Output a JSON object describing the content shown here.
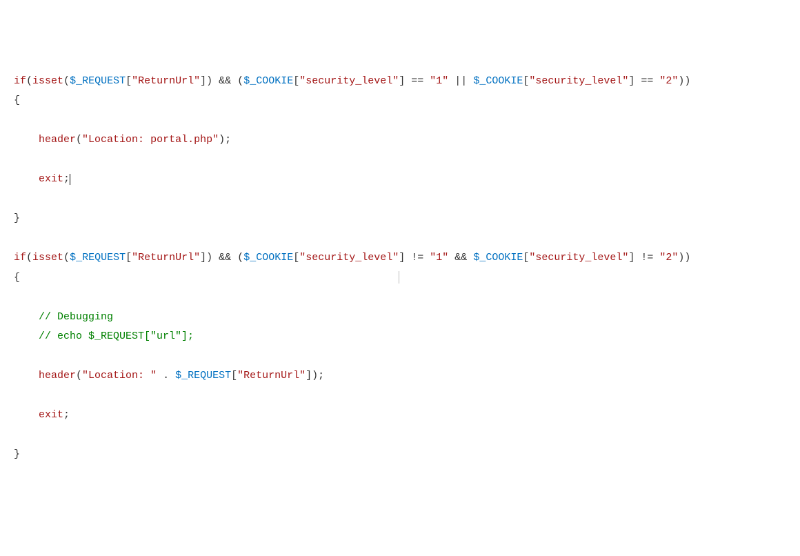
{
  "code": {
    "line1": {
      "kw_if": "if",
      "p_open": "(",
      "kw_isset": "isset",
      "p1": "(",
      "var_req1": "$_REQUEST",
      "br1": "[",
      "str_return": "\"ReturnUrl\"",
      "br1c": "]",
      "p1c": ")",
      "sp_amp": " && ",
      "p2": "(",
      "var_cook1": "$_COOKIE",
      "br2": "[",
      "str_sec1": "\"security_level\"",
      "br2c": "]",
      "eq": " == ",
      "str_1": "\"1\"",
      "or": " || ",
      "var_cook2": "$_COOKIE",
      "br3": "[",
      "str_sec2": "\"security_level\"",
      "br3c": "]",
      "eq2": " == ",
      "str_2": "\"2\"",
      "p2c": "))"
    },
    "line2": "{",
    "line3": "",
    "line4": {
      "indent": "    ",
      "kw_header": "header",
      "p": "(",
      "str": "\"Location: portal.php\"",
      "pc": ");"
    },
    "line5": "",
    "line6": {
      "indent": "    ",
      "kw_exit": "exit",
      "semi": ";"
    },
    "line7": "",
    "line8": "}",
    "line9": "",
    "line10": {
      "kw_if": "if",
      "p_open": "(",
      "kw_isset": "isset",
      "p1": "(",
      "var_req1": "$_REQUEST",
      "br1": "[",
      "str_return": "\"ReturnUrl\"",
      "br1c": "]",
      "p1c": ")",
      "sp_amp": " && ",
      "p2": "(",
      "var_cook1": "$_COOKIE",
      "br2": "[",
      "str_sec1": "\"security_level\"",
      "br2c": "]",
      "neq": " != ",
      "str_1": "\"1\"",
      "and": " && ",
      "var_cook2": "$_COOKIE",
      "br3": "[",
      "str_sec2": "\"security_level\"",
      "br3c": "]",
      "neq2": " != ",
      "str_2": "\"2\"",
      "p2c": "))"
    },
    "line11": "{",
    "line12": "",
    "line13": {
      "indent": "    ",
      "cmt": "// Debugging"
    },
    "line14": {
      "indent": "    ",
      "cmt": "// echo $_REQUEST[\"url\"];"
    },
    "line15": "",
    "line16": {
      "indent": "    ",
      "kw_header": "header",
      "p": "(",
      "str1": "\"Location: \"",
      "concat": " . ",
      "var_req": "$_REQUEST",
      "br": "[",
      "str2": "\"ReturnUrl\"",
      "brc": "]",
      "pc": ");"
    },
    "line17": "",
    "line18": {
      "indent": "    ",
      "kw_exit": "exit",
      "semi": ";"
    },
    "line19": "",
    "line20": "}"
  }
}
